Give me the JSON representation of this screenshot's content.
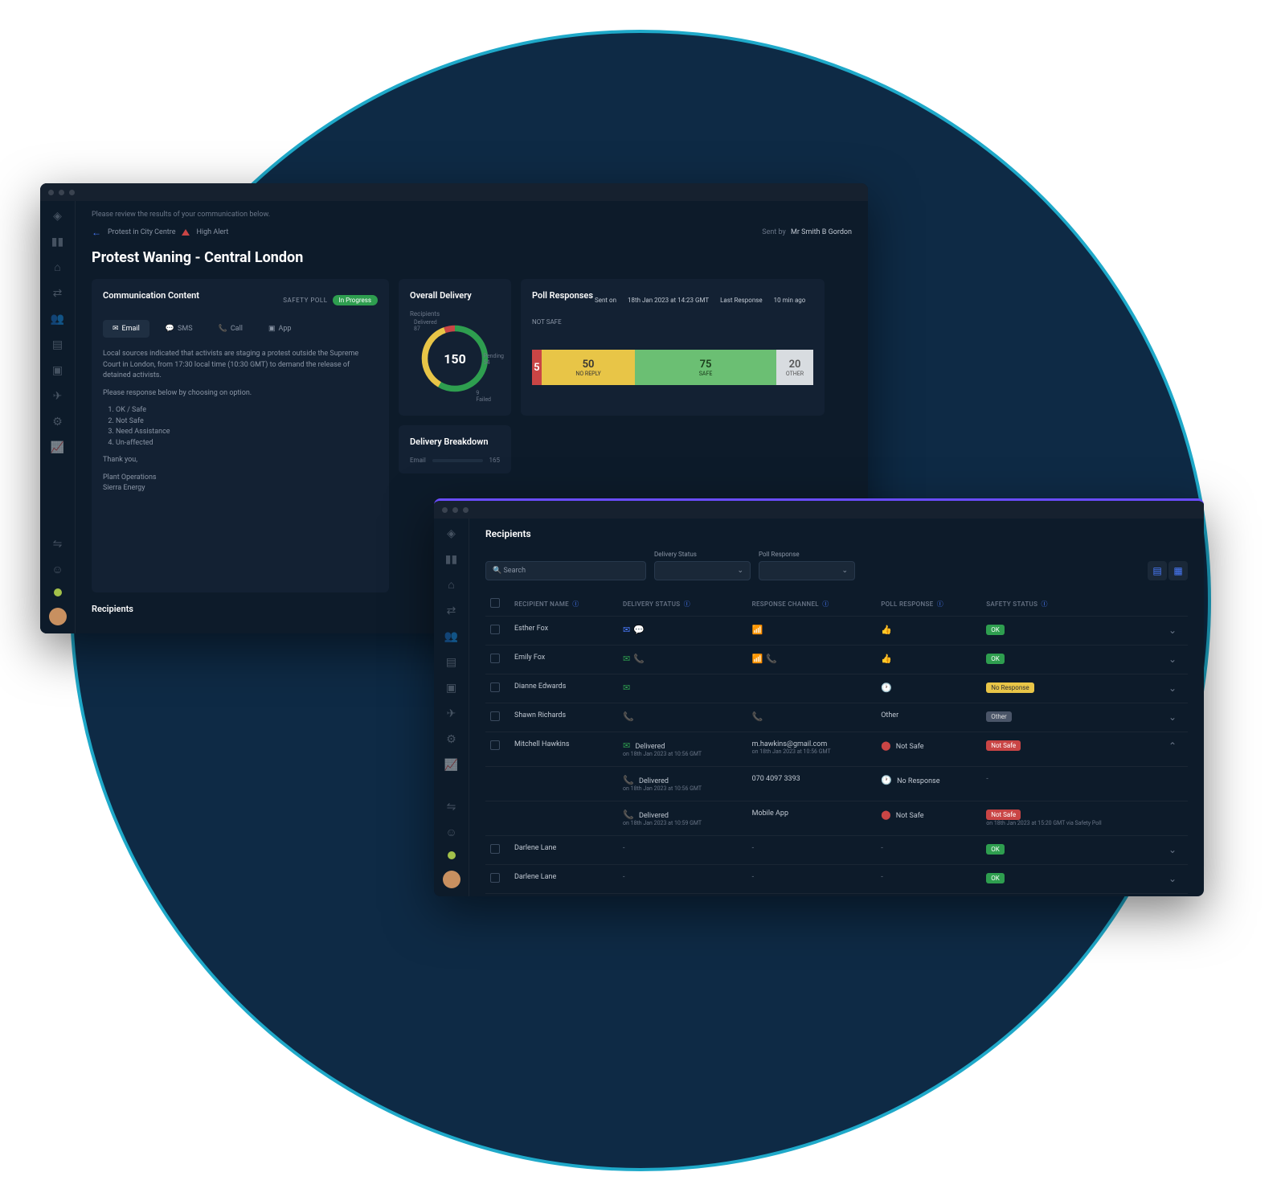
{
  "window1": {
    "subheader": "Please review the results of your communication below.",
    "breadcrumb": {
      "item": "Protest in City Centre",
      "alert": "High Alert",
      "sent_by_lbl": "Sent by",
      "sent_by_name": "Mr Smith B Gordon"
    },
    "title": "Protest Waning - Central London",
    "comm": {
      "title": "Communication Content",
      "poll_lbl": "SAFETY POLL",
      "status": "In Progress",
      "tabs": {
        "email": "Email",
        "sms": "SMS",
        "call": "Call",
        "app": "App"
      },
      "body": {
        "p1": "Local sources indicated that activists are staging a protest outside the Supreme Court in London, from 17:30 local time (10:30 GMT) to demand the release of detained activists.",
        "p2": "Please response below by choosing on option.",
        "o1": "OK / Safe",
        "o2": "Not Safe",
        "o3": "Need Assistance",
        "o4": "Un-affected",
        "p3": "Thank you,",
        "p4": "Plant Operations",
        "p5": "Sierra Energy"
      }
    },
    "delivery": {
      "title": "Overall Delivery",
      "rec_lbl": "Recipients",
      "total": "150",
      "delivered_lbl": "Delivered",
      "delivered": "87",
      "pending_lbl": "Pending",
      "pending": "54",
      "failed_lbl": "Failed",
      "failed": "9"
    },
    "poll": {
      "title": "Poll Responses",
      "sent_lbl": "Sent on",
      "sent_val": "18th Jan 2023 at 14:23 GMT",
      "last_lbl": "Last Response",
      "last_val": "10 min ago",
      "cat_lbl": "NOT SAFE"
    },
    "breakdown": {
      "title": "Delivery Breakdown",
      "row1": "Email",
      "val1": "165"
    },
    "section2": "Recipients"
  },
  "chart_data": {
    "type": "bar",
    "title": "Poll Responses",
    "categories": [
      "NOT SAFE",
      "NO REPLY",
      "SAFE",
      "OTHER"
    ],
    "values": [
      5,
      50,
      75,
      20
    ],
    "colors": [
      "#c94545",
      "#e8c547",
      "#6bbf73",
      "#d8dce0"
    ]
  },
  "window2": {
    "title": "Recipients",
    "filters": {
      "search_ph": "Search",
      "ds_lbl": "Delivery Status",
      "pr_lbl": "Poll Response"
    },
    "cols": {
      "name": "RECIPIENT NAME",
      "ds": "DELIVERY STATUS",
      "rc": "RESPONSE CHANNEL",
      "pr": "POLL RESPONSE",
      "ss": "SAFETY STATUS"
    },
    "rows": [
      {
        "name": "Esther Fox",
        "badge": "OK"
      },
      {
        "name": "Emily Fox",
        "badge": "OK"
      },
      {
        "name": "Dianne Edwards",
        "badge": "No Response"
      },
      {
        "name": "Shawn Richards",
        "poll": "Other",
        "badge": "Other"
      },
      {
        "name": "Mitchell Hawkins"
      },
      {
        "name": "Darlene Lane",
        "badge": "OK"
      },
      {
        "name": "Darlene Lane",
        "badge": "OK"
      }
    ],
    "expanded": {
      "d1_status": "Delivered",
      "d1_sub": "on 18th Jan 2023\nat 10:56 GMT",
      "d1_rc": "m.hawkins@gmail.com",
      "d1_rc_sub": "on 18th Jan 2023\nat 10:56 GMT",
      "d1_poll": "Not Safe",
      "d1_badge": "Not Safe",
      "d2_status": "Delivered",
      "d2_sub": "on 18th Jan 2023\nat 10:56 GMT",
      "d2_rc": "070 4097 3393",
      "d2_poll": "No Response",
      "d3_status": "Delivered",
      "d3_sub": "on 18th Jan 2023\nat 10:59 GMT",
      "d3_rc": "Mobile App",
      "d3_poll": "Not Safe",
      "d3_badge": "Not Safe",
      "d3_ss_sub": "on 18th Jan 2023 at 15:20 GMT\nvia Safety Poll"
    }
  }
}
